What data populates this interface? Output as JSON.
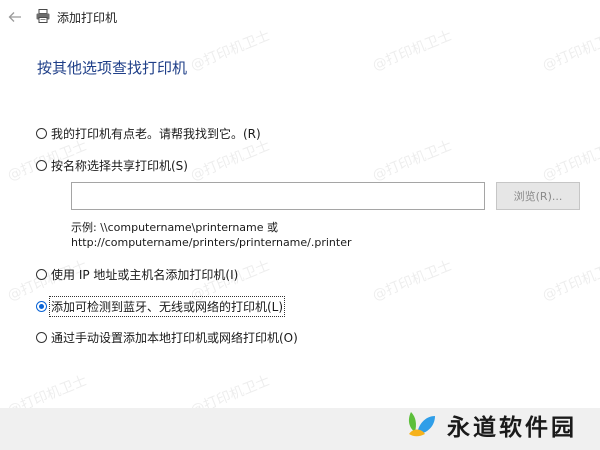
{
  "window": {
    "title": "添加打印机",
    "back_icon": "back-arrow-icon",
    "printer_icon": "printer-icon"
  },
  "heading": "按其他选项查找打印机",
  "options": [
    {
      "label": "我的打印机有点老。请帮我找到它。(R)",
      "selected": false
    },
    {
      "label": "按名称选择共享打印机(S)",
      "selected": false
    },
    {
      "label": "使用 IP 地址或主机名添加打印机(I)",
      "selected": false
    },
    {
      "label": "添加可检测到蓝牙、无线或网络的打印机(L)",
      "selected": true
    },
    {
      "label": "通过手动设置添加本地打印机或网络打印机(O)",
      "selected": false
    }
  ],
  "share_input": {
    "value": ""
  },
  "browse_button": "浏览(R)...",
  "example": {
    "line1": "示例: \\\\computername\\printername 或",
    "line2": "http://computername/printers/printername/.printer"
  },
  "watermark": "@打印机卫士",
  "brand": {
    "name": "永道软件园"
  },
  "colors": {
    "heading": "#1f3f88",
    "radio_selected": "#0a64d6",
    "footer_bg": "#f0f0f0",
    "button_disabled_bg": "#e6e6e6"
  }
}
